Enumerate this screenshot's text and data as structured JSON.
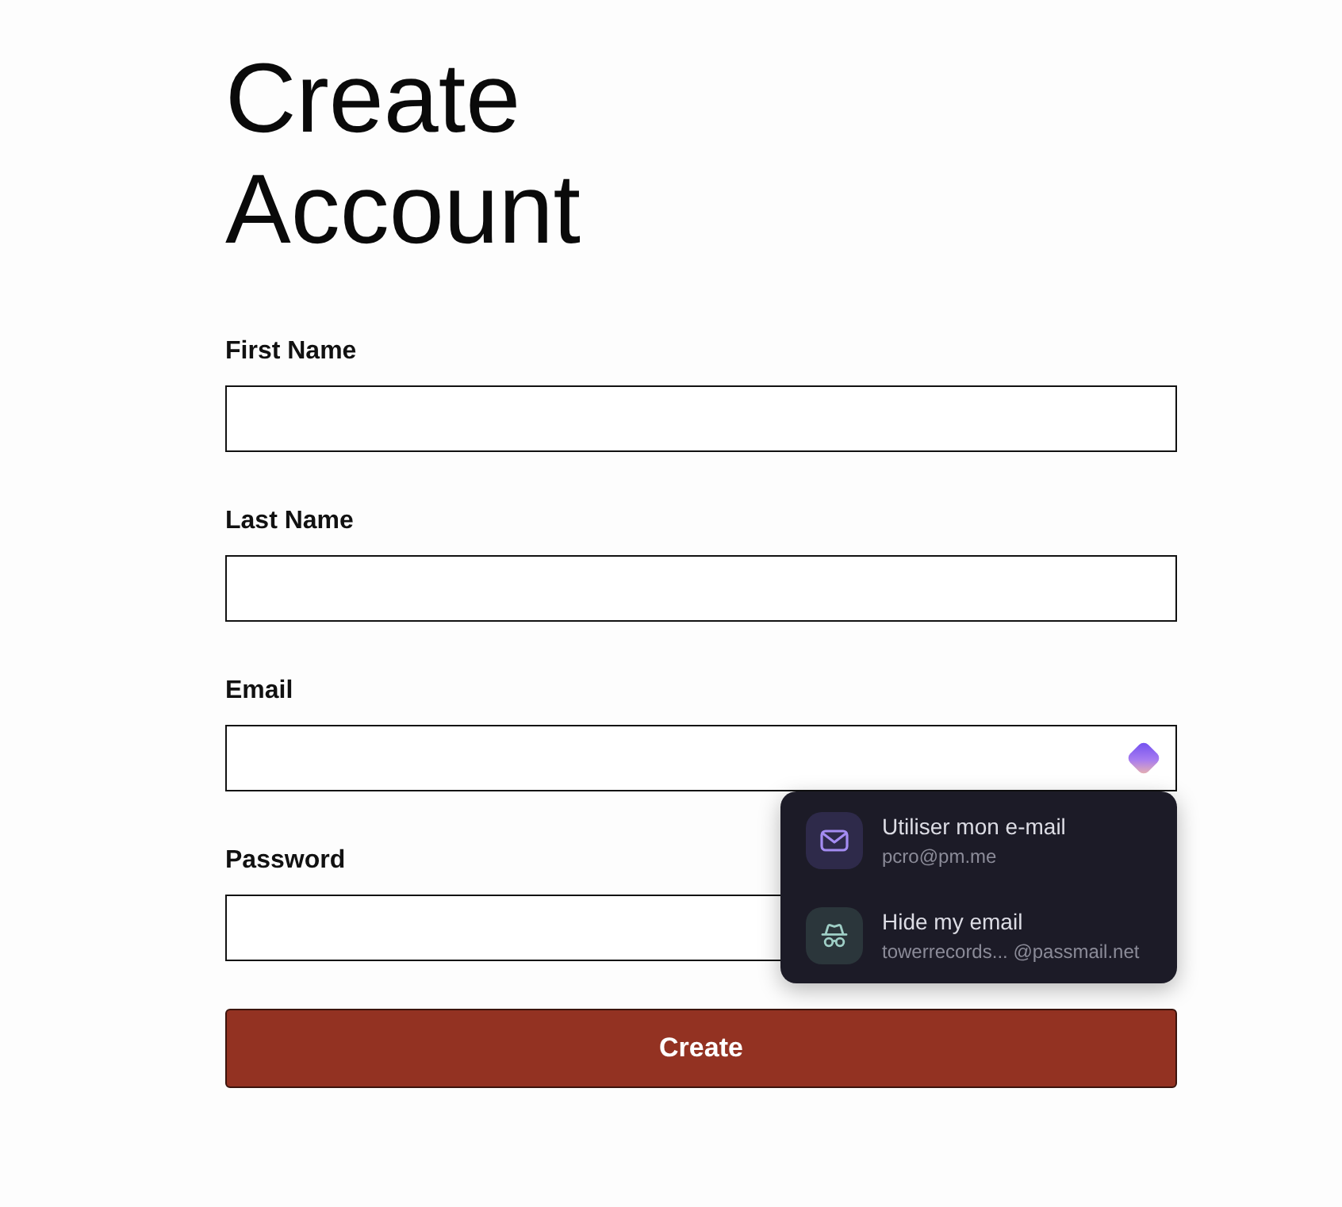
{
  "title": "Create Account",
  "fields": [
    {
      "label": "First Name",
      "autofill_icon": false
    },
    {
      "label": "Last Name",
      "autofill_icon": false
    },
    {
      "label": "Email",
      "autofill_icon": true,
      "suggestions": [
        {
          "kind": "mailbox",
          "title": "Utiliser mon e-mail",
          "subtitle": "pcro@pm.me"
        },
        {
          "kind": "alias",
          "title": "Hide my email",
          "subtitle": "towerrecords... @passmail.net"
        }
      ]
    },
    {
      "label": "Password",
      "autofill_icon": false
    }
  ],
  "button": {
    "label": "Create"
  }
}
